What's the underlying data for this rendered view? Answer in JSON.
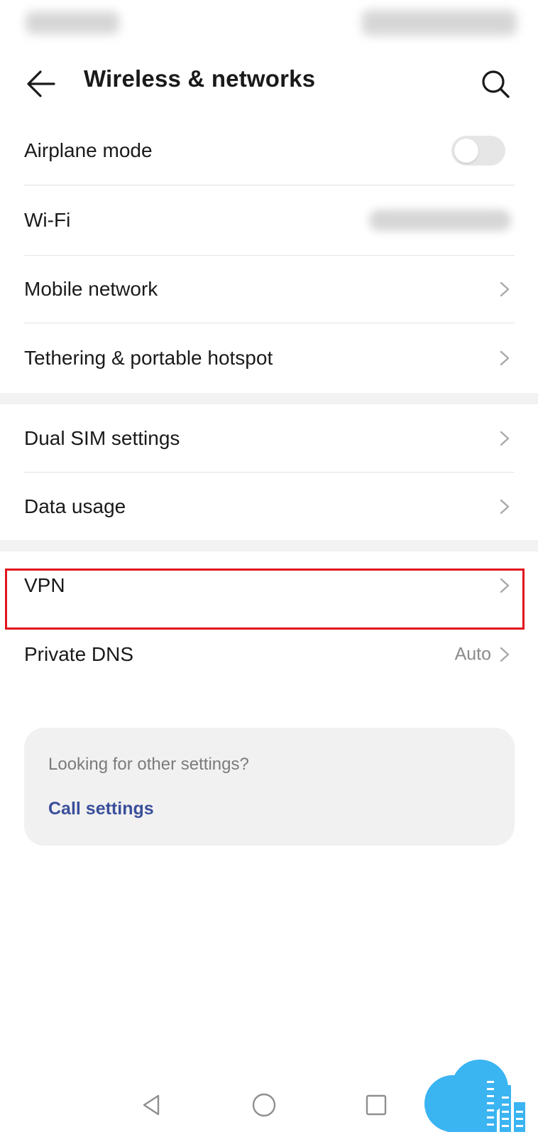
{
  "app_bar": {
    "title": "Wireless & networks"
  },
  "items": [
    {
      "label": "Airplane mode"
    },
    {
      "label": "Wi-Fi"
    },
    {
      "label": "Mobile network"
    },
    {
      "label": "Tethering & portable hotspot"
    },
    {
      "label": "Dual SIM settings"
    },
    {
      "label": "Data usage"
    },
    {
      "label": "VPN"
    },
    {
      "label": "Private DNS",
      "value": "Auto"
    }
  ],
  "airplane_mode": {
    "enabled": false
  },
  "suggestion_card": {
    "hint": "Looking for other settings?",
    "link": "Call settings"
  },
  "colors": {
    "highlight_border": "#e0141e",
    "link": "#3a4f9b",
    "watermark_cloud": "#3bb4f2"
  },
  "icons": [
    "back-arrow-icon",
    "search-icon",
    "chevron-right-icon",
    "nav-back-icon",
    "nav-home-icon",
    "nav-recents-icon",
    "cloud-logo-icon"
  ]
}
